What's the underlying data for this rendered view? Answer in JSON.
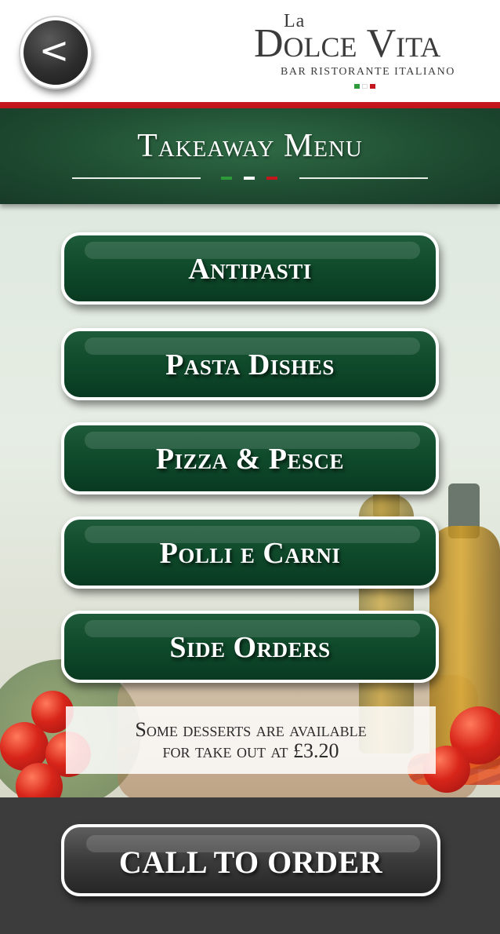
{
  "header": {
    "back_glyph": "<",
    "logo": {
      "la": "La",
      "name": "Dolce Vita",
      "subtitle": "BAR RISTORANTE ITALIANO",
      "flag_colors": [
        "#2e9b3a",
        "#ffffff",
        "#c4161c"
      ]
    },
    "accent_rule_color": "#c4161c"
  },
  "banner": {
    "title": "Takeaway Menu",
    "dash_colors": [
      "#2e9b3a",
      "#ffffff",
      "#c4161c"
    ]
  },
  "menu": {
    "items": [
      {
        "label": "Antipasti"
      },
      {
        "label": "Pasta Dishes"
      },
      {
        "label": "Pizza & Pesce"
      },
      {
        "label": "Polli e Carni"
      },
      {
        "label": "Side Orders"
      }
    ],
    "button_color": "#0f4a2b"
  },
  "note": {
    "line1": "Some desserts are available",
    "line2": "for take out at £3.20"
  },
  "footer": {
    "call_label": "CALL TO ORDER",
    "button_color": "#3b3b3b"
  }
}
